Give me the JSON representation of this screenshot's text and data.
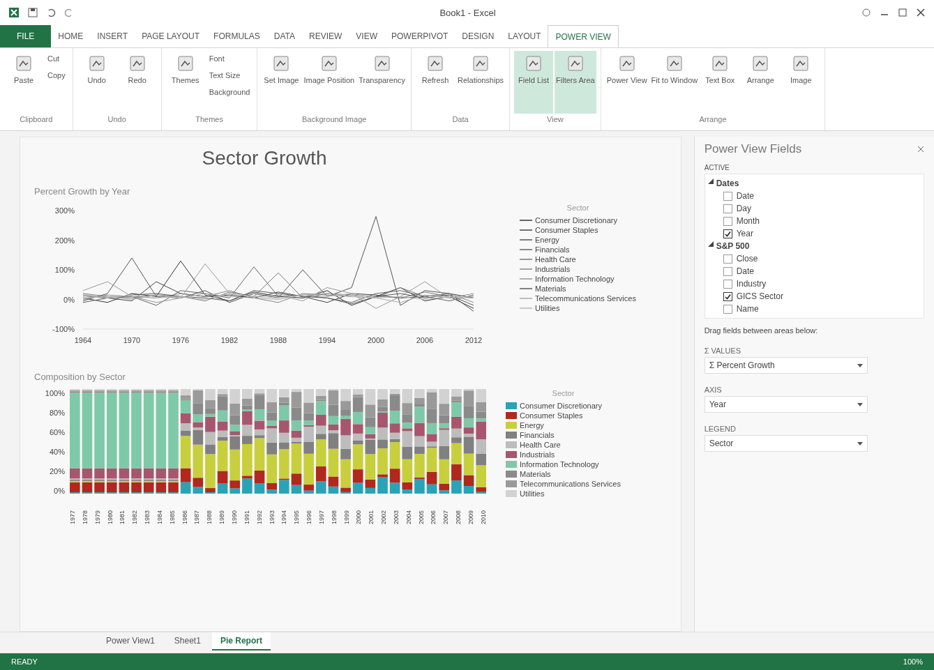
{
  "window": {
    "title": "Book1 - Excel"
  },
  "ribbon_tabs": [
    {
      "label": "FILE",
      "selected": false,
      "kind": "file"
    },
    {
      "label": "HOME",
      "selected": false
    },
    {
      "label": "INSERT",
      "selected": false
    },
    {
      "label": "PAGE LAYOUT",
      "selected": false
    },
    {
      "label": "FORMULAS",
      "selected": false
    },
    {
      "label": "DATA",
      "selected": false
    },
    {
      "label": "REVIEW",
      "selected": false
    },
    {
      "label": "VIEW",
      "selected": false
    },
    {
      "label": "POWERPIVOT",
      "selected": false
    },
    {
      "label": "DESIGN",
      "selected": false
    },
    {
      "label": "LAYOUT",
      "selected": false
    },
    {
      "label": "POWER VIEW",
      "selected": true
    }
  ],
  "ribbon_groups": [
    {
      "label": "Clipboard",
      "buttons": [
        {
          "label": "Paste",
          "kind": "large"
        },
        {
          "label": "Cut",
          "kind": "small"
        },
        {
          "label": "Copy",
          "kind": "small"
        }
      ]
    },
    {
      "label": "Undo",
      "buttons": [
        {
          "label": "Undo",
          "kind": "large"
        },
        {
          "label": "Redo",
          "kind": "large"
        }
      ]
    },
    {
      "label": "Themes",
      "buttons": [
        {
          "label": "Themes",
          "kind": "large"
        },
        {
          "label": "Font",
          "kind": "small"
        },
        {
          "label": "Text Size",
          "kind": "small"
        },
        {
          "label": "Background",
          "kind": "small"
        }
      ]
    },
    {
      "label": "Background Image",
      "buttons": [
        {
          "label": "Set Image",
          "kind": "large"
        },
        {
          "label": "Image Position",
          "kind": "large"
        },
        {
          "label": "Transparency",
          "kind": "large"
        }
      ]
    },
    {
      "label": "Data",
      "buttons": [
        {
          "label": "Refresh",
          "kind": "large"
        },
        {
          "label": "Relationships",
          "kind": "large"
        }
      ]
    },
    {
      "label": "View",
      "buttons": [
        {
          "label": "Field List",
          "kind": "large",
          "on": true
        },
        {
          "label": "Filters Area",
          "kind": "large",
          "on": true
        }
      ]
    },
    {
      "label": "Arrange",
      "buttons": [
        {
          "label": "Power View",
          "kind": "large",
          "on": false
        },
        {
          "label": "Fit to Window",
          "kind": "large",
          "on": false
        },
        {
          "label": "Text Box",
          "kind": "large",
          "on": false
        },
        {
          "label": "Arrange",
          "kind": "large",
          "on": false
        },
        {
          "label": "Image",
          "kind": "large",
          "on": false
        }
      ]
    }
  ],
  "report": {
    "title": "Sector Growth",
    "line_chart": {
      "legend_title": "Sector",
      "chart_data": {
        "type": "line",
        "title": "Percent Growth by Year",
        "x": [
          1964,
          1967,
          1970,
          1973,
          1976,
          1979,
          1982,
          1985,
          1988,
          1991,
          1994,
          1997,
          2000,
          2003,
          2006,
          2009,
          2012
        ],
        "xticks": [
          1964,
          1970,
          1976,
          1982,
          1988,
          1994,
          2000,
          2006,
          2012
        ],
        "yticks": [
          {
            "value": 300,
            "label": "300%"
          },
          {
            "value": 200,
            "label": "200%"
          },
          {
            "value": 100,
            "label": "100%"
          },
          {
            "value": 0,
            "label": "0%"
          },
          {
            "value": -100,
            "label": "-100%"
          }
        ],
        "xlim": [
          1964,
          2012
        ],
        "ylim": [
          -100,
          300
        ],
        "legend": "right",
        "series": [
          {
            "name": "Consumer Discretionary",
            "color": "#333333",
            "values": [
              5,
              -10,
              20,
              10,
              130,
              15,
              -5,
              25,
              10,
              5,
              30,
              -20,
              10,
              40,
              -5,
              10,
              -30
            ]
          },
          {
            "name": "Consumer Staples",
            "color": "#444444",
            "values": [
              10,
              5,
              -5,
              60,
              20,
              10,
              15,
              5,
              25,
              10,
              -10,
              20,
              15,
              5,
              10,
              20,
              5
            ]
          },
          {
            "name": "Energy",
            "color": "#555555",
            "values": [
              -5,
              20,
              140,
              10,
              5,
              30,
              -10,
              20,
              5,
              100,
              10,
              40,
              280,
              -20,
              30,
              20,
              -40
            ]
          },
          {
            "name": "Financials",
            "color": "#666666",
            "values": [
              15,
              5,
              10,
              -20,
              30,
              20,
              5,
              110,
              10,
              15,
              5,
              -10,
              20,
              30,
              10,
              -5,
              15
            ]
          },
          {
            "name": "Health Care",
            "color": "#777777",
            "values": [
              20,
              10,
              5,
              15,
              10,
              -5,
              25,
              10,
              90,
              5,
              20,
              15,
              10,
              5,
              25,
              10,
              5
            ]
          },
          {
            "name": "Industrials",
            "color": "#888888",
            "values": [
              0,
              15,
              10,
              5,
              20,
              10,
              30,
              5,
              -10,
              20,
              15,
              10,
              5,
              40,
              10,
              20,
              -10
            ]
          },
          {
            "name": "Information Technology",
            "color": "#999999",
            "values": [
              30,
              60,
              10,
              -10,
              5,
              120,
              20,
              10,
              15,
              -5,
              40,
              20,
              -30,
              10,
              60,
              5,
              20
            ]
          },
          {
            "name": "Materials",
            "color": "#5a5a5a",
            "values": [
              -10,
              5,
              15,
              20,
              10,
              5,
              -5,
              30,
              20,
              10,
              5,
              -15,
              10,
              20,
              5,
              15,
              -20
            ]
          },
          {
            "name": "Telecommunications Services",
            "color": "#aaaaaa",
            "values": [
              5,
              10,
              0,
              15,
              5,
              20,
              10,
              5,
              0,
              15,
              20,
              10,
              5,
              -10,
              15,
              5,
              10
            ]
          },
          {
            "name": "Utilities",
            "color": "#bbbbbb",
            "values": [
              10,
              5,
              15,
              5,
              10,
              0,
              20,
              10,
              5,
              15,
              10,
              20,
              5,
              10,
              0,
              10,
              5
            ]
          }
        ]
      }
    },
    "bar_chart": {
      "title": "Composition by Sector",
      "yticks": [
        "100%",
        "80%",
        "60%",
        "40%",
        "20%",
        "0%"
      ],
      "xticks": [
        "1977",
        "1978",
        "1979",
        "1980",
        "1981",
        "1982",
        "1983",
        "1984",
        "1985",
        "1986",
        "1987",
        "1988",
        "1989",
        "1990",
        "1991",
        "1992",
        "1993",
        "1994",
        "1995",
        "1996",
        "1997",
        "1998",
        "1999",
        "2000",
        "2001",
        "2002",
        "2003",
        "2004",
        "2005",
        "2006",
        "2007",
        "2008",
        "2009",
        "2010"
      ],
      "legend_title": "Sector",
      "legend": [
        {
          "label": "Consumer Discretionary",
          "color": "#2aa3b8"
        },
        {
          "label": "Consumer Staples",
          "color": "#b0281e"
        },
        {
          "label": "Energy",
          "color": "#c8cf3c"
        },
        {
          "label": "Financials",
          "color": "#808080"
        },
        {
          "label": "Health Care",
          "color": "#bdbdbd"
        },
        {
          "label": "Industrials",
          "color": "#a8566e"
        },
        {
          "label": "Information Technology",
          "color": "#7ec9a8"
        },
        {
          "label": "Materials",
          "color": "#8a8a8a"
        },
        {
          "label": "Telecommunications Services",
          "color": "#9a9a9a"
        },
        {
          "label": "Utilities",
          "color": "#d2d2d2"
        }
      ]
    }
  },
  "fields_pane": {
    "title": "Power View Fields",
    "tab": "ACTIVE",
    "tables": [
      {
        "name": "Dates",
        "expanded": true,
        "fields": [
          {
            "name": "Date",
            "checked": false
          },
          {
            "name": "Day",
            "checked": false
          },
          {
            "name": "Month",
            "checked": false
          },
          {
            "name": "Year",
            "checked": true
          }
        ]
      },
      {
        "name": "S&P 500",
        "expanded": true,
        "fields": [
          {
            "name": "Close",
            "checked": false
          },
          {
            "name": "Date",
            "checked": false
          },
          {
            "name": "Industry",
            "checked": false
          },
          {
            "name": "GICS Sector",
            "checked": true
          },
          {
            "name": "Name",
            "checked": false
          }
        ]
      }
    ],
    "hint": "Drag fields between areas below:",
    "values_label": "Σ VALUES",
    "values_field": "Σ Percent Growth",
    "axis_label": "AXIS",
    "axis_field": "Year",
    "legend_label": "LEGEND",
    "legend_field": "Sector"
  },
  "sheet_tabs": [
    {
      "label": "Power View1",
      "selected": false
    },
    {
      "label": "Sheet1",
      "selected": false
    },
    {
      "label": "Pie Report",
      "selected": true
    }
  ],
  "status_bar": {
    "status": "READY",
    "zoom": "100%"
  }
}
